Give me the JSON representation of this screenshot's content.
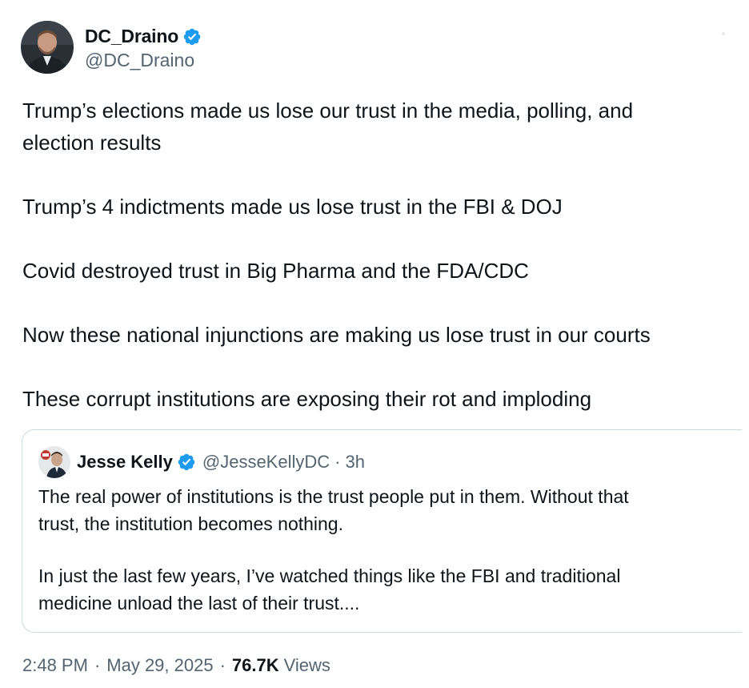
{
  "author": {
    "display_name": "DC_Draino",
    "handle": "@DC_Draino",
    "verified": true,
    "avatar_icon": "profile-photo"
  },
  "body": {
    "paragraphs": [
      "Trump’s elections made us lose our trust in the media, polling, and",
      "election results",
      "Trump’s 4 indictments made us lose trust in the FBI & DOJ",
      "Covid destroyed trust in Big Pharma and the FDA/CDC",
      "Now these national injunctions are making us lose trust in our courts",
      "These corrupt institutions are exposing their rot and imploding"
    ]
  },
  "quote": {
    "display_name": "Jesse Kelly",
    "handle": "@JesseKellyDC",
    "separator": "·",
    "time": "3h",
    "verified": true,
    "lines": [
      "The real power of institutions is the trust people put in them. Without that",
      "trust, the institution becomes nothing.",
      "In just the last few years, I’ve watched things like the FBI and traditional",
      "medicine unload the last of their trust...."
    ]
  },
  "footer": {
    "time": "2:48 PM",
    "separator": "·",
    "date": "May 29, 2025",
    "separator2": "·",
    "views_count": "76.7K",
    "views_label": "Views"
  },
  "colors": {
    "verified_blue": "#1d9bf0",
    "text_primary": "#0f1419",
    "text_secondary": "#536471",
    "border": "#cfd9de"
  }
}
